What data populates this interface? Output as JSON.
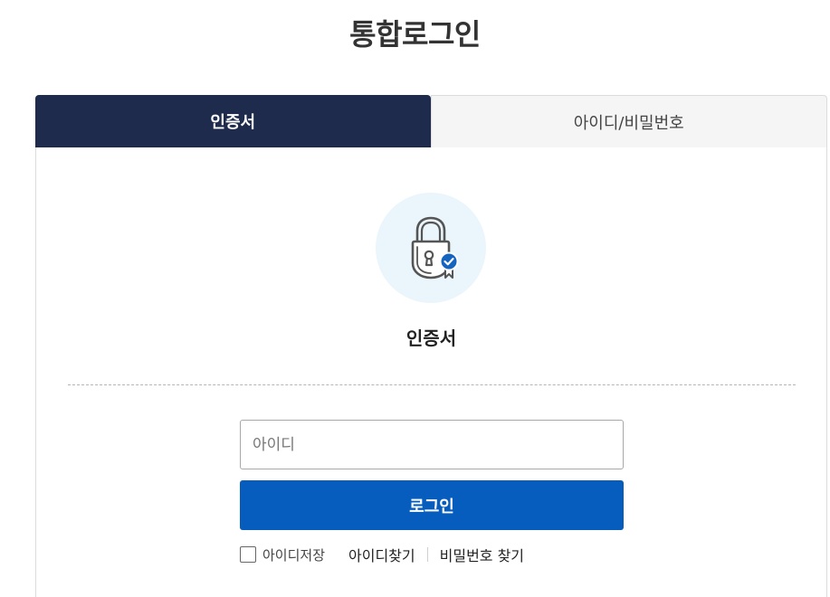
{
  "page": {
    "title": "통합로그인"
  },
  "tabs": [
    {
      "label": "인증서",
      "active": true
    },
    {
      "label": "아이디/비밀번호",
      "active": false
    }
  ],
  "cert_section": {
    "icon": "lock-certificate-icon",
    "label": "인증서"
  },
  "login_form": {
    "id_placeholder": "아이디",
    "id_value": "",
    "login_button": "로그인",
    "save_id_label": "아이디저장",
    "save_id_checked": false,
    "find_id_link": "아이디찾기",
    "find_password_link": "비밀번호 찾기"
  },
  "colors": {
    "active_tab": "#1e2b4d",
    "primary_button": "#065dbd",
    "icon_circle": "#eaf6fb",
    "badge": "#1565c0"
  }
}
